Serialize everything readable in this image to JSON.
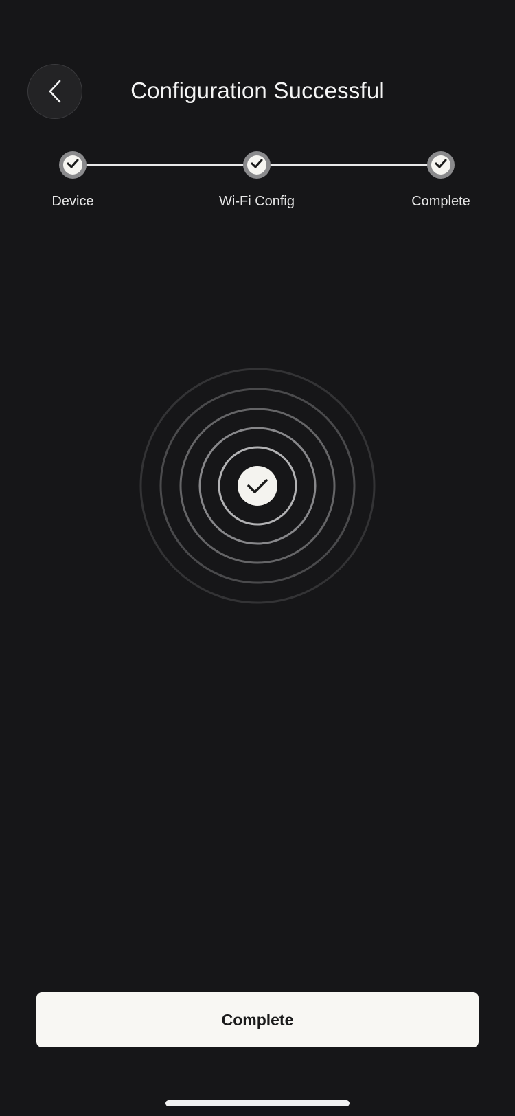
{
  "header": {
    "title": "Configuration Successful",
    "back_icon": "chevron-left-icon"
  },
  "stepper": {
    "steps": [
      {
        "label": "Device",
        "status": "done"
      },
      {
        "label": "Wi-Fi Config",
        "status": "done"
      },
      {
        "label": "Complete",
        "status": "done"
      }
    ],
    "step_icon": "check-icon"
  },
  "success": {
    "icon": "check-circle-icon",
    "ring_count": 5
  },
  "footer": {
    "complete_label": "Complete"
  },
  "colors": {
    "background": "#161618",
    "accent": "#f8f7f3",
    "step_ring": "#8a8a8c"
  }
}
